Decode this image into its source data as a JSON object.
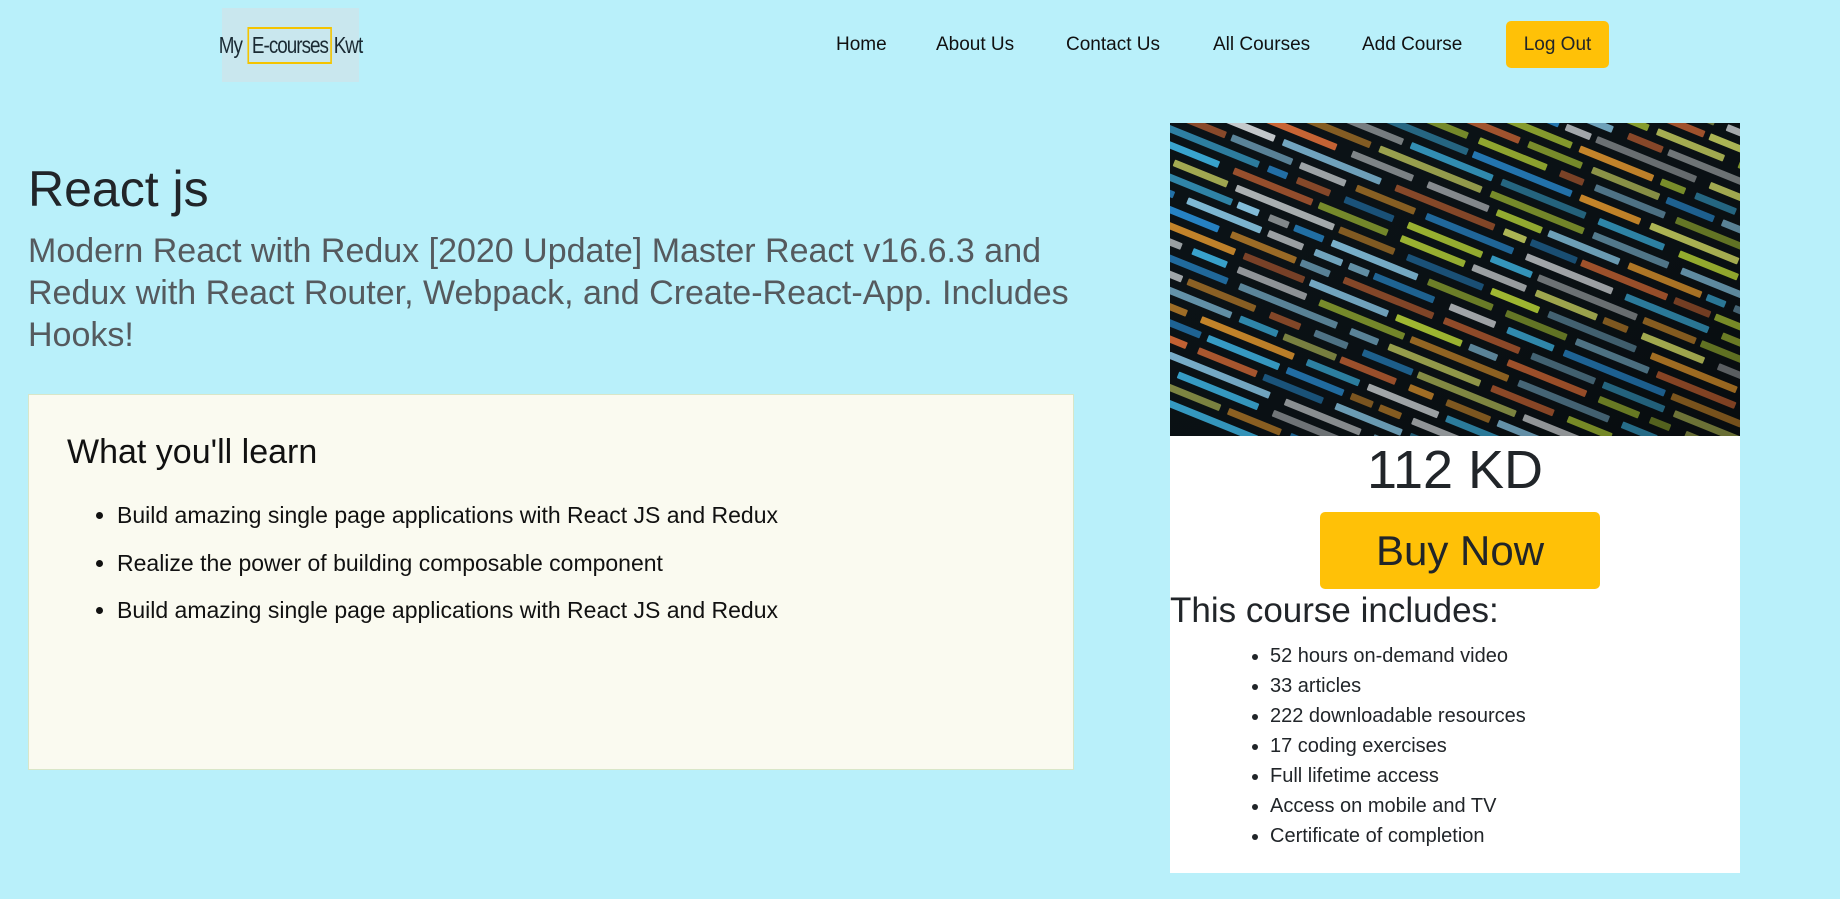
{
  "navbar": {
    "logo": {
      "prefix": "My",
      "boxed": "E-courses",
      "suffix": "Kwt"
    },
    "links": [
      {
        "label": "Home"
      },
      {
        "label": "About Us"
      },
      {
        "label": "Contact Us"
      },
      {
        "label": "All Courses"
      },
      {
        "label": "Add Course"
      }
    ],
    "logout_label": "Log Out"
  },
  "course": {
    "title": "React js",
    "subtitle": "Modern React with Redux [2020 Update] Master React v16.6.3 and Redux with React Router, Webpack, and Create-React-App. Includes Hooks!",
    "learn": {
      "heading": "What you'll learn",
      "items": [
        "Build amazing single page applications with React JS and Redux",
        "Realize the power of building composable component",
        "Build amazing single page applications with React JS and Redux"
      ]
    }
  },
  "sidebar": {
    "image_icon": "code-screen-image",
    "price": "112 KD",
    "buy_label": "Buy Now",
    "includes": {
      "heading": "This course includes:",
      "items": [
        "52 hours on-demand video",
        "33 articles",
        "222 downloadable resources",
        "17 coding exercises",
        "Full lifetime access",
        "Access on mobile and TV",
        "Certificate of completion"
      ]
    }
  },
  "colors": {
    "page_background": "#b9f0fa",
    "accent": "#ffc107",
    "learn_box": "#fafaf0"
  }
}
